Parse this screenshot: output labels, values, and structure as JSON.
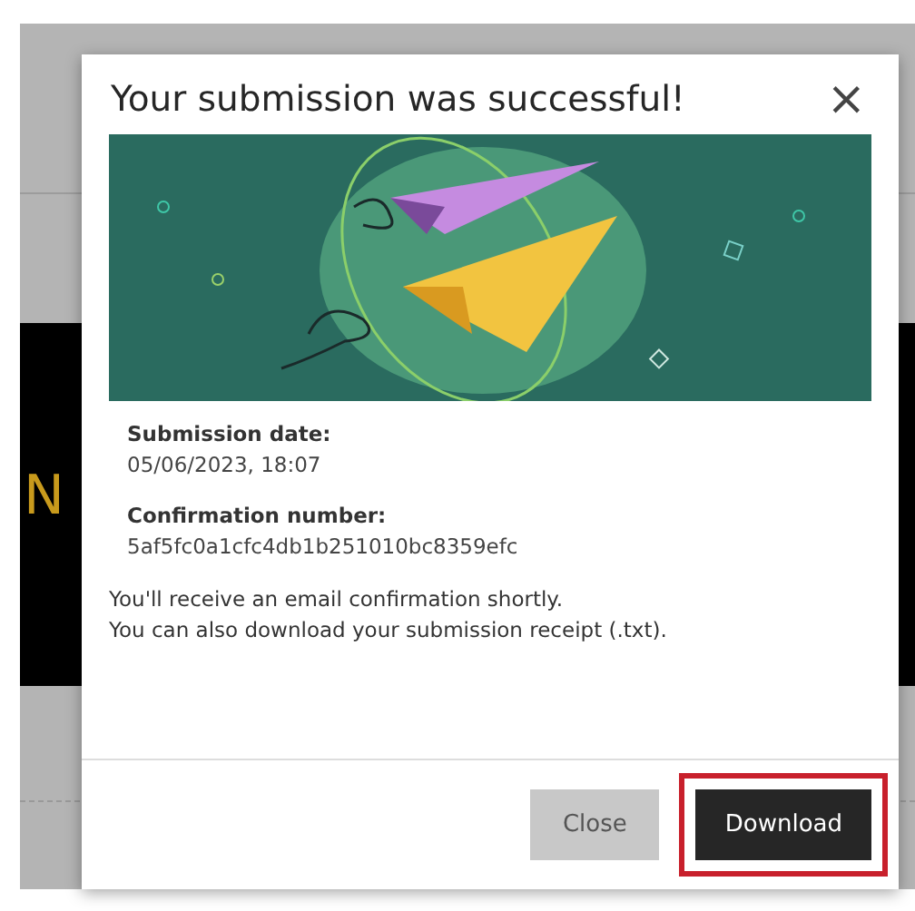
{
  "backdrop_text": "N",
  "dialog": {
    "title": "Your submission was successful!",
    "close_icon": "×",
    "details": [
      {
        "label": "Submission date:",
        "value": "05/06/2023, 18:07"
      },
      {
        "label": "Confirmation number:",
        "value": "5af5fc0a1cfc4db1b251010bc8359efc"
      }
    ],
    "message": [
      "You'll receive an email confirmation shortly.",
      "You can also download your submission receipt (.txt)."
    ],
    "buttons": [
      {
        "label": "Close",
        "kind": "secondary",
        "highlighted": false
      },
      {
        "label": "Download",
        "kind": "primary",
        "highlighted": true
      }
    ]
  }
}
